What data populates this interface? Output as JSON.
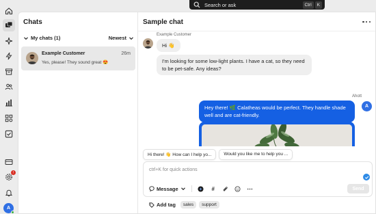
{
  "search": {
    "placeholder": "Search or ask",
    "shortcut_keys": [
      "Ctrl",
      "K"
    ]
  },
  "rail": {
    "items": [
      {
        "name": "home-icon"
      },
      {
        "name": "inbox-icon",
        "active": true
      },
      {
        "name": "sparkle-icon"
      },
      {
        "name": "bolt-icon"
      },
      {
        "name": "archive-icon"
      },
      {
        "name": "contacts-icon"
      },
      {
        "name": "reports-icon"
      },
      {
        "name": "apps-icon"
      },
      {
        "name": "checklist-icon"
      },
      {
        "name": "card-icon"
      },
      {
        "name": "settings-icon",
        "badge": "!"
      },
      {
        "name": "bell-icon"
      }
    ],
    "user_initial": "A"
  },
  "chats_panel": {
    "title": "Chats",
    "filter_label": "My chats (1)",
    "sort_label": "Newest",
    "conversations": [
      {
        "name": "Example Customer",
        "time": "26m",
        "preview": "Yes, please! They sound great 😍"
      }
    ]
  },
  "chat": {
    "title": "Sample chat",
    "customer_name": "Example Customer",
    "messages_in": [
      "Hi 👋",
      "I'm looking for some low-light plants. I have a cat, so they need to be pet-safe. Any ideas?"
    ],
    "agent_name": "Ahott",
    "agent_initial": "A",
    "message_out": "Hey there! 🌿 Calatheas would be perfect. They handle shade well and are cat-friendly.",
    "suggestions": [
      "Hi there! 👋 How can I help yo...",
      "Would you like me to help you ..."
    ],
    "composer": {
      "placeholder": "ctrl+K for quick actions",
      "message_type": "Message",
      "send_label": "Send"
    },
    "add_tag_label": "Add tag",
    "tags": [
      "sales",
      "support"
    ]
  },
  "colors": {
    "accent": "#1560e3",
    "avatar": "#2f6fe4",
    "badge": "#d93025",
    "online": "#3cb043"
  }
}
